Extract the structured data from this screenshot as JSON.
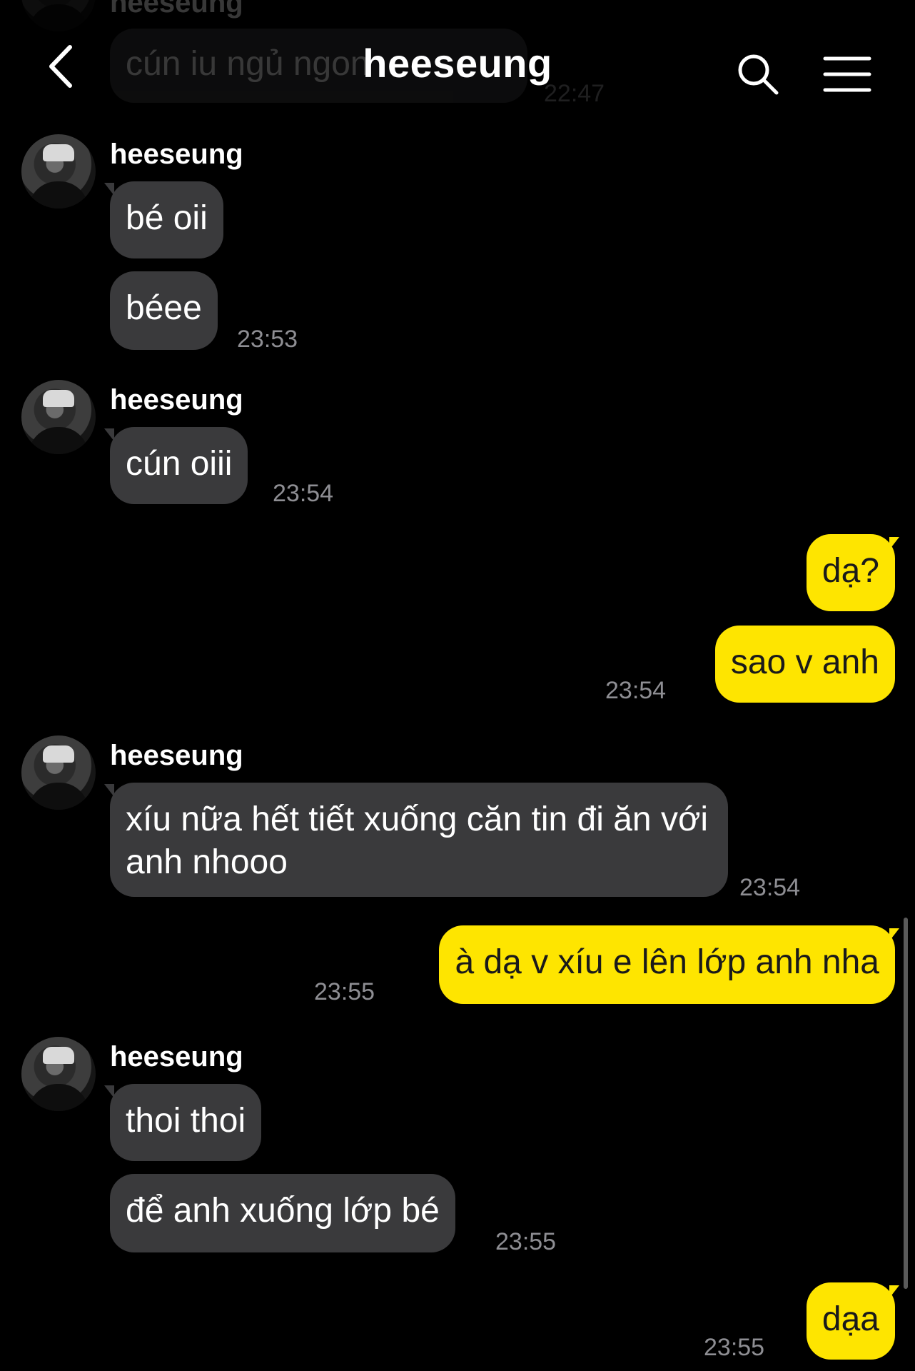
{
  "header": {
    "title": "heeseung",
    "back_icon": "chevron-left-icon",
    "search_icon": "search-icon",
    "menu_icon": "hamburger-menu-icon"
  },
  "previous": {
    "sender": "heeseung",
    "text": "cún iu ngủ ngon",
    "time": "22:47"
  },
  "groups": [
    {
      "sender": "heeseung",
      "messages": [
        "bé oii",
        "béee"
      ],
      "time": "23:53"
    },
    {
      "sender": "heeseung",
      "messages": [
        "cún oiii"
      ],
      "time": "23:54"
    },
    {
      "side": "out",
      "messages": [
        "dạ?",
        "sao v anh"
      ],
      "time": "23:54"
    },
    {
      "sender": "heeseung",
      "messages": [
        "xíu nữa hết tiết xuống căn tin đi ăn với anh nhooo"
      ],
      "time": "23:54"
    },
    {
      "side": "out",
      "messages": [
        "à dạ v xíu e lên lớp anh nha"
      ],
      "time": "23:55"
    },
    {
      "sender": "heeseung",
      "messages": [
        "thoi thoi",
        "để anh xuống lớp bé"
      ],
      "time": "23:55"
    },
    {
      "side": "out",
      "messages": [
        "dạa"
      ],
      "time": "23:55"
    }
  ],
  "colors": {
    "background": "#000000",
    "incoming_bubble": "#3a3a3c",
    "outgoing_bubble": "#fee500",
    "timestamp": "#8e8e93"
  }
}
